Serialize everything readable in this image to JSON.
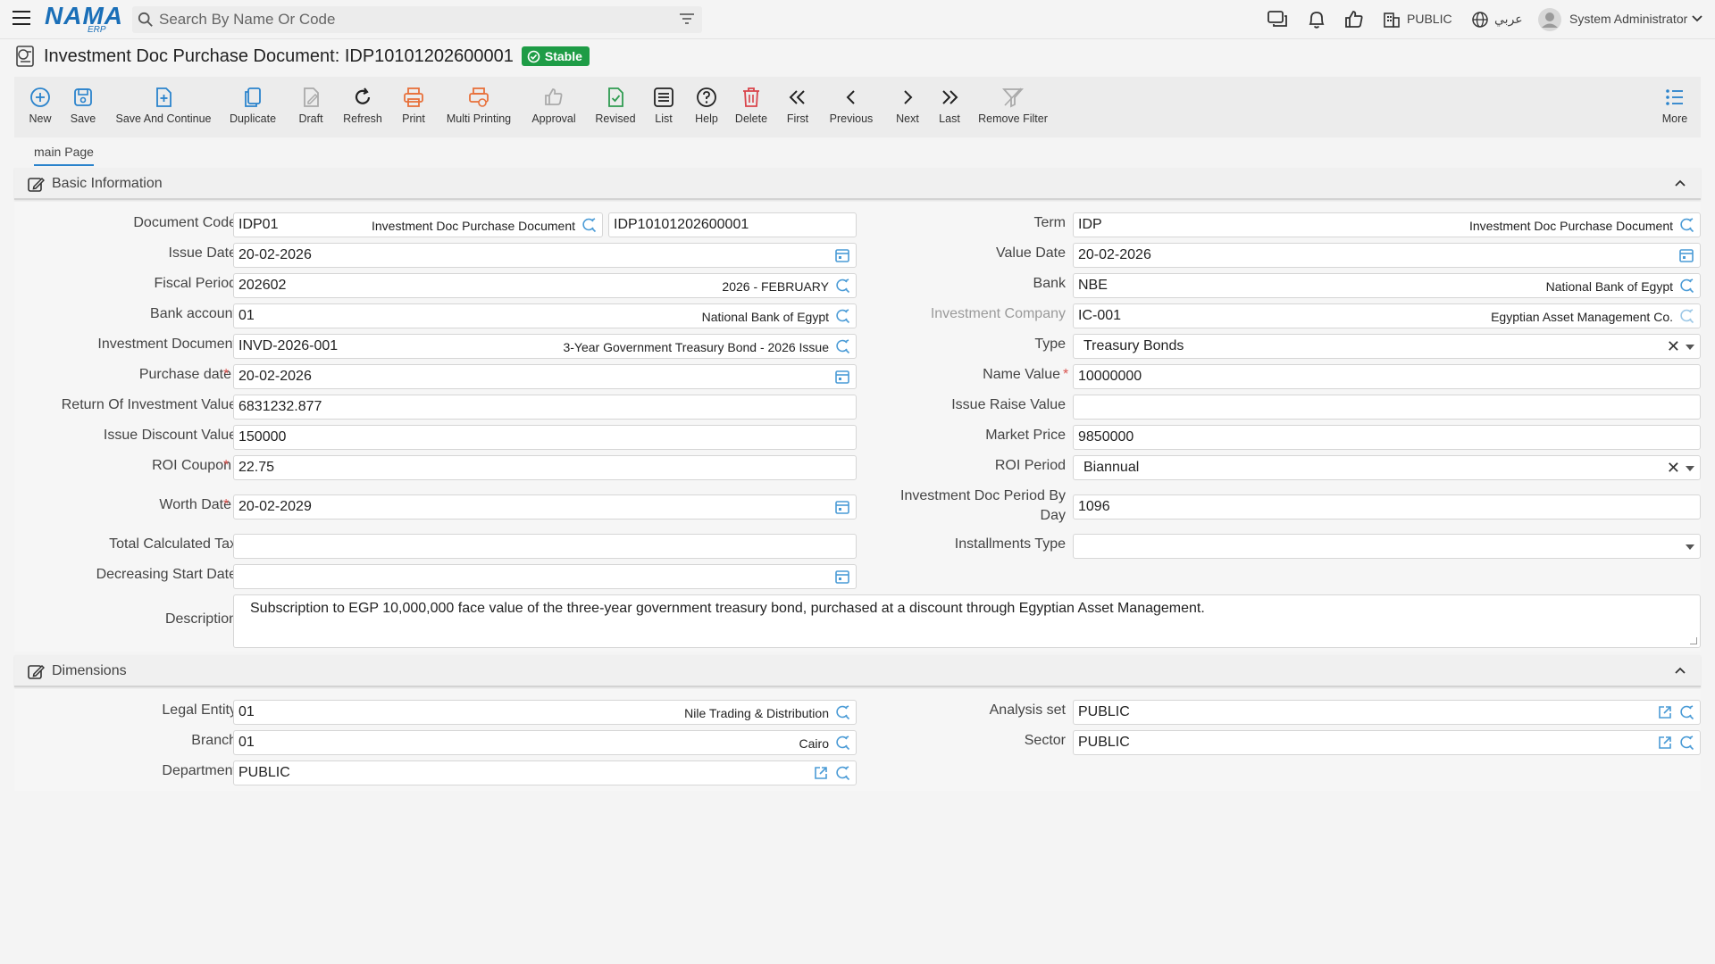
{
  "app": {
    "logo_text": "NAMA",
    "logo_sub": "ERP",
    "search_placeholder": "Search By Name Or Code",
    "public_label": "PUBLIC",
    "language_label": "عربي",
    "user_name": "System Administrator"
  },
  "page": {
    "title": "Investment Doc Purchase Document: IDP10101202600001",
    "status": "Stable",
    "status_color": "#1e9c46"
  },
  "toolbar": {
    "new": "New",
    "save": "Save",
    "save_continue": "Save And Continue",
    "duplicate": "Duplicate",
    "draft": "Draft",
    "refresh": "Refresh",
    "print": "Print",
    "multi_printing": "Multi Printing",
    "approval": "Approval",
    "revised": "Revised",
    "list": "List",
    "help": "Help",
    "delete": "Delete",
    "first": "First",
    "previous": "Previous",
    "next": "Next",
    "last": "Last",
    "remove_filter": "Remove Filter",
    "more": "More"
  },
  "tabs": {
    "main": "main Page"
  },
  "basic": {
    "title": "Basic Information",
    "document_code": {
      "label": "Document Code",
      "code": "IDP01",
      "name": "Investment Doc Purchase Document",
      "number": "IDP10101202600001"
    },
    "term": {
      "label": "Term",
      "code": "IDP",
      "name": "Investment Doc Purchase Document"
    },
    "issue_date": {
      "label": "Issue Date",
      "value": "20-02-2026"
    },
    "value_date": {
      "label": "Value Date",
      "value": "20-02-2026"
    },
    "fiscal_period": {
      "label": "Fiscal Period",
      "code": "202602",
      "name": "2026 - FEBRUARY"
    },
    "bank": {
      "label": "Bank",
      "code": "NBE",
      "name": "National Bank of Egypt"
    },
    "bank_account": {
      "label": "Bank account",
      "code": "01",
      "name": "National Bank of Egypt"
    },
    "investment_company": {
      "label": "Investment Company",
      "code": "IC-001",
      "name": "Egyptian Asset Management Co."
    },
    "investment_document": {
      "label": "Investment Document",
      "code": "INVD-2026-001",
      "name": "3-Year Government Treasury Bond - 2026 Issue"
    },
    "type": {
      "label": "Type",
      "value": "Treasury Bonds"
    },
    "purchase_date": {
      "label": "Purchase date",
      "value": "20-02-2026"
    },
    "name_value": {
      "label": "Name Value",
      "value": "10000000"
    },
    "return_of_investment": {
      "label": "Return Of Investment Value",
      "value": "6831232.877"
    },
    "issue_raise_value": {
      "label": "Issue Raise Value",
      "value": ""
    },
    "issue_discount_value": {
      "label": "Issue Discount Value",
      "value": "150000"
    },
    "market_price": {
      "label": "Market Price",
      "value": "9850000"
    },
    "roi_coupon": {
      "label": "ROI Coupon",
      "value": "22.75"
    },
    "roi_period": {
      "label": "ROI Period",
      "value": "Biannual"
    },
    "worth_date": {
      "label": "Worth Date",
      "value": "20-02-2029"
    },
    "period_by_day": {
      "label_line1": "Investment Doc Period By",
      "label_line2": "Day",
      "value": "1096"
    },
    "total_calculated_tax": {
      "label": "Total Calculated Tax",
      "value": ""
    },
    "installments_type": {
      "label": "Installments Type",
      "value": ""
    },
    "decreasing_start_date": {
      "label": "Decreasing Start Date",
      "value": ""
    },
    "description": {
      "label": "Description",
      "value": "Subscription to EGP 10,000,000 face value of the three-year government treasury bond, purchased at a discount through Egyptian Asset Management."
    }
  },
  "dimensions": {
    "title": "Dimensions",
    "legal_entity": {
      "label": "Legal Entity",
      "code": "01",
      "name": "Nile Trading & Distribution"
    },
    "analysis_set": {
      "label": "Analysis set",
      "value": "PUBLIC"
    },
    "branch": {
      "label": "Branch",
      "code": "01",
      "name": "Cairo"
    },
    "sector": {
      "label": "Sector",
      "value": "PUBLIC"
    },
    "department": {
      "label": "Department",
      "value": "PUBLIC"
    }
  }
}
